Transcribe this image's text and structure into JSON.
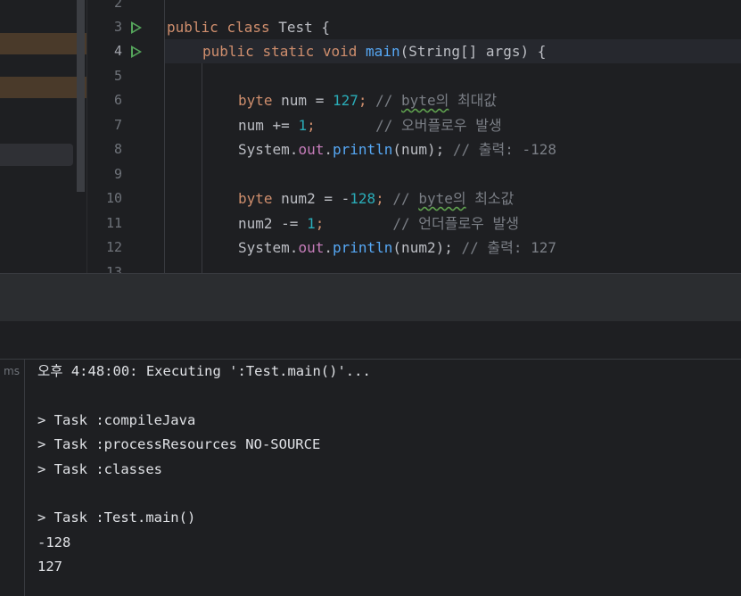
{
  "editor": {
    "line_numbers": [
      "2",
      "3",
      "4",
      "5",
      "6",
      "7",
      "8",
      "9",
      "10",
      "11",
      "12",
      "13"
    ],
    "run_icons": [
      "run-gutter-icon",
      "run-gutter-icon"
    ],
    "lines": {
      "l3": {
        "kw1": "public",
        "kw2": "class",
        "name": "Test",
        "tail": " {"
      },
      "l4": {
        "kw1": "public",
        "kw2": "static",
        "kw3": "void",
        "fn": "main",
        "p1": "(",
        "type": "String",
        "p2": "[] ",
        "arg": "args",
        "p3": ") {"
      },
      "l6": {
        "kw": "byte",
        "mid": " num = ",
        "num": "127",
        "semi": ";",
        "cm1": " // ",
        "cm_ul": "byte의",
        "cm2": " 최대값"
      },
      "l7": {
        "pre": "num += ",
        "num": "1",
        "semi": ";",
        "pad": "       ",
        "cm": "// 오버플로우 발생"
      },
      "l8": {
        "sys": "System",
        "dot1": ".",
        "fld": "out",
        "dot2": ".",
        "fn": "println",
        "args": "(num);",
        "cm": " // 출력: -128"
      },
      "l10": {
        "kw": "byte",
        "mid": " num2 = -",
        "num": "128",
        "semi": ";",
        "cm1": " // ",
        "cm_ul": "byte의",
        "cm2": " 최소값"
      },
      "l11": {
        "pre": "num2 -= ",
        "num": "1",
        "semi": ";",
        "pad": "        ",
        "cm": "// 언더플로우 발생"
      },
      "l12": {
        "sys": "System",
        "dot1": ".",
        "fld": "out",
        "dot2": ".",
        "fn": "println",
        "args": "(num2);",
        "cm": " // 출력: 127"
      }
    }
  },
  "console": {
    "gutter_label": "ms",
    "lines": [
      "오후 4:48:00: Executing ':Test.main()'...",
      "",
      "> Task :compileJava",
      "> Task :processResources NO-SOURCE",
      "> Task :classes",
      "",
      "> Task :Test.main()",
      "-128",
      "127"
    ]
  }
}
